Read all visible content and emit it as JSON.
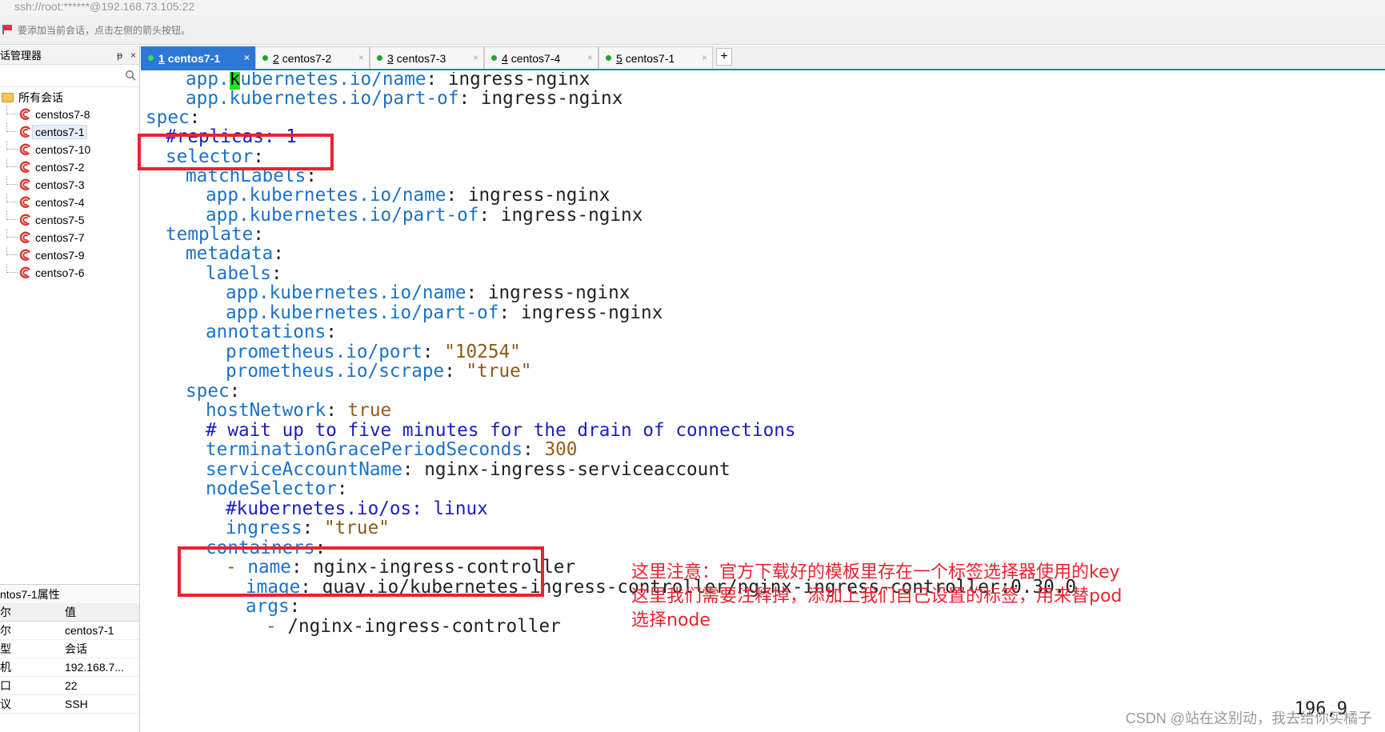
{
  "window": {
    "address": "ssh://root:******@192.168.73.105:22",
    "hint": "要添加当前会话，点击左侧的箭头按钮。"
  },
  "sidebar": {
    "title": "话管理器",
    "pin": "ᵽ",
    "close": "×",
    "root_label": "所有会话",
    "sessions": [
      "censtos7-8",
      "centos7-1",
      "centos7-10",
      "centos7-2",
      "centos7-3",
      "centos7-4",
      "centos7-5",
      "centos7-7",
      "centos7-9",
      "centso7-6"
    ],
    "props_title": "ntos7-1属性",
    "props_header": {
      "key": "尔",
      "value": "值"
    },
    "props": [
      {
        "key": "尔",
        "value": "centos7-1"
      },
      {
        "key": "型",
        "value": "会话"
      },
      {
        "key": "机",
        "value": "192.168.7..."
      },
      {
        "key": "口",
        "value": "22"
      },
      {
        "key": "议",
        "value": "SSH"
      }
    ]
  },
  "tabs": [
    {
      "num": "1",
      "label": "centos7-1",
      "active": true
    },
    {
      "num": "2",
      "label": "centos7-2",
      "active": false
    },
    {
      "num": "3",
      "label": "centos7-3",
      "active": false
    },
    {
      "num": "4",
      "label": "centos7-4",
      "active": false
    },
    {
      "num": "5",
      "label": "centos7-1",
      "active": false
    }
  ],
  "tab_close": "×",
  "tab_add": "+",
  "terminal": {
    "lines": [
      {
        "indent": 4,
        "parts": [
          [
            "c",
            "app."
          ],
          [
            "cursor",
            "k"
          ],
          [
            "c",
            "ubernetes.io/name"
          ],
          [
            "w",
            ": ingress-nginx"
          ]
        ]
      },
      {
        "indent": 4,
        "parts": [
          [
            "c",
            "app.kubernetes.io/part-of"
          ],
          [
            "w",
            ": ingress-nginx"
          ]
        ]
      },
      {
        "indent": 0,
        "parts": [
          [
            "c",
            "spec"
          ],
          [
            "w",
            ":"
          ]
        ]
      },
      {
        "indent": 2,
        "parts": [
          [
            "cm",
            "#replicas: 1"
          ]
        ]
      },
      {
        "indent": 2,
        "parts": [
          [
            "c",
            "selector"
          ],
          [
            "w",
            ":"
          ]
        ]
      },
      {
        "indent": 4,
        "parts": [
          [
            "c",
            "matchLabels"
          ],
          [
            "w",
            ":"
          ]
        ]
      },
      {
        "indent": 6,
        "parts": [
          [
            "c",
            "app.kubernetes.io/name"
          ],
          [
            "w",
            ": ingress-nginx"
          ]
        ]
      },
      {
        "indent": 6,
        "parts": [
          [
            "c",
            "app.kubernetes.io/part-of"
          ],
          [
            "w",
            ": ingress-nginx"
          ]
        ]
      },
      {
        "indent": 2,
        "parts": [
          [
            "c",
            "template"
          ],
          [
            "w",
            ":"
          ]
        ]
      },
      {
        "indent": 4,
        "parts": [
          [
            "c",
            "metadata"
          ],
          [
            "w",
            ":"
          ]
        ]
      },
      {
        "indent": 6,
        "parts": [
          [
            "c",
            "labels"
          ],
          [
            "w",
            ":"
          ]
        ]
      },
      {
        "indent": 8,
        "parts": [
          [
            "c",
            "app.kubernetes.io/name"
          ],
          [
            "w",
            ": ingress-nginx"
          ]
        ]
      },
      {
        "indent": 8,
        "parts": [
          [
            "c",
            "app.kubernetes.io/part-of"
          ],
          [
            "w",
            ": ingress-nginx"
          ]
        ]
      },
      {
        "indent": 6,
        "parts": [
          [
            "c",
            "annotations"
          ],
          [
            "w",
            ":"
          ]
        ]
      },
      {
        "indent": 8,
        "parts": [
          [
            "c",
            "prometheus.io/port"
          ],
          [
            "w",
            ": "
          ],
          [
            "s",
            "\"10254\""
          ]
        ]
      },
      {
        "indent": 8,
        "parts": [
          [
            "c",
            "prometheus.io/scrape"
          ],
          [
            "w",
            ": "
          ],
          [
            "s",
            "\"true\""
          ]
        ]
      },
      {
        "indent": 4,
        "parts": [
          [
            "c",
            "spec"
          ],
          [
            "w",
            ":"
          ]
        ]
      },
      {
        "indent": 6,
        "parts": [
          [
            "c",
            "hostNetwork"
          ],
          [
            "w",
            ": "
          ],
          [
            "t",
            "true"
          ]
        ]
      },
      {
        "indent": 6,
        "parts": [
          [
            "cm",
            "# wait up to five minutes for the drain of connections"
          ]
        ]
      },
      {
        "indent": 6,
        "parts": [
          [
            "c",
            "terminationGracePeriodSeconds"
          ],
          [
            "w",
            ": "
          ],
          [
            "t",
            "300"
          ]
        ]
      },
      {
        "indent": 6,
        "parts": [
          [
            "c",
            "serviceAccountName"
          ],
          [
            "w",
            ": nginx-ingress-serviceaccount"
          ]
        ]
      },
      {
        "indent": 6,
        "parts": [
          [
            "c",
            "nodeSelector"
          ],
          [
            "w",
            ":"
          ]
        ]
      },
      {
        "indent": 8,
        "parts": [
          [
            "cm",
            "#kubernetes.io/os: linux"
          ]
        ]
      },
      {
        "indent": 8,
        "parts": [
          [
            "c",
            "ingress"
          ],
          [
            "w",
            ": "
          ],
          [
            "s",
            "\"true\""
          ]
        ]
      },
      {
        "indent": 6,
        "parts": [
          [
            "c",
            "containers"
          ],
          [
            "w",
            ":"
          ]
        ]
      },
      {
        "indent": 8,
        "parts": [
          [
            "t",
            "- "
          ],
          [
            "c",
            "name"
          ],
          [
            "w",
            ": nginx-ingress-controller"
          ]
        ]
      },
      {
        "indent": 10,
        "parts": [
          [
            "c",
            "image"
          ],
          [
            "w",
            ": quay.io/kubernetes-ingress-controller/nginx-ingress-controller:0.30.0"
          ]
        ]
      },
      {
        "indent": 10,
        "parts": [
          [
            "c",
            "args"
          ],
          [
            "w",
            ":"
          ]
        ]
      },
      {
        "indent": 12,
        "parts": [
          [
            "t",
            "- "
          ],
          [
            "w",
            "/nginx-ingress-controller"
          ]
        ]
      }
    ],
    "cursor_position": "196,9"
  },
  "annotation": {
    "lines": [
      "这里注意：官方下载好的模板里存在一个标签选择器使用的key",
      "这里我们需要注释掉，添加上我们自己设置的标签，用来替pod",
      "选择node"
    ]
  },
  "watermark": "CSDN @站在这别动，我去给你买橘子",
  "colors": {
    "accent": "#2c78d6",
    "yaml_key": "#1c72c8",
    "yaml_comment": "#1d1dc0",
    "yaml_string": "#8a5a1c",
    "highlight_box": "#e82431",
    "session_icon": "#d9362e"
  }
}
